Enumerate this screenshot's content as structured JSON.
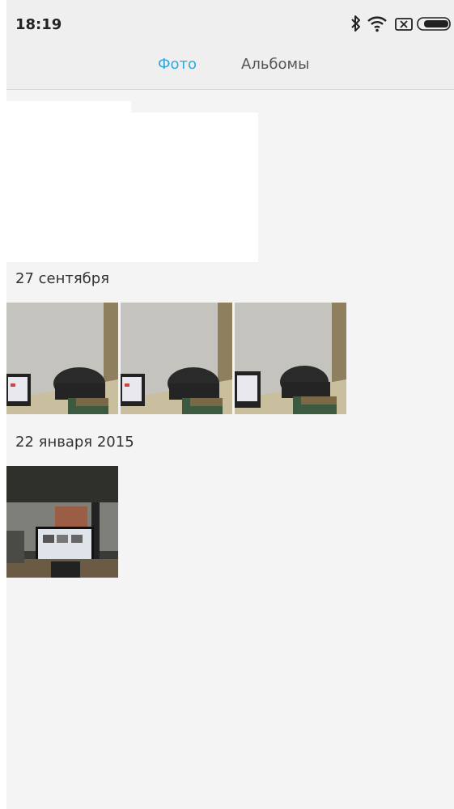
{
  "status_bar": {
    "time": "18:19",
    "icons": [
      "bluetooth-icon",
      "wifi-icon",
      "sim-off-icon",
      "battery-icon"
    ]
  },
  "tabs": [
    {
      "label": "Фото",
      "active": true
    },
    {
      "label": "Альбомы",
      "active": false
    }
  ],
  "sections": [
    {
      "date": "27 сентября",
      "photo_count": 3
    },
    {
      "date": "22 января 2015",
      "photo_count": 1
    }
  ],
  "colors": {
    "accent": "#33a6de",
    "background": "#f4f4f4",
    "bar": "#efefef"
  }
}
